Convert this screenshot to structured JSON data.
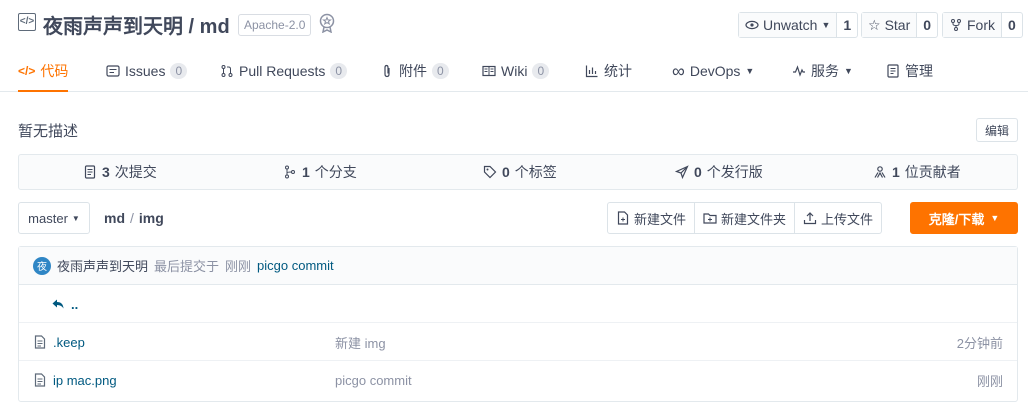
{
  "repo": {
    "icon": "code-repo-icon",
    "title": "夜雨声声到天明 / md",
    "license": "Apache-2.0"
  },
  "social": {
    "watch_label": "Unwatch",
    "watch_count": "1",
    "star_label": "Star",
    "star_count": "0",
    "fork_label": "Fork",
    "fork_count": "0"
  },
  "tabs": [
    {
      "label": "代码",
      "count": ""
    },
    {
      "label": "Issues",
      "count": "0"
    },
    {
      "label": "Pull Requests",
      "count": "0"
    },
    {
      "label": "附件",
      "count": "0"
    },
    {
      "label": "Wiki",
      "count": "0"
    },
    {
      "label": "统计",
      "count": ""
    },
    {
      "label": "DevOps",
      "count": ""
    },
    {
      "label": "服务",
      "count": ""
    },
    {
      "label": "管理",
      "count": ""
    }
  ],
  "description": "暂无描述",
  "edit_label": "编辑",
  "stats": [
    {
      "num": "3",
      "label": "次提交"
    },
    {
      "num": "1",
      "label": "个分支"
    },
    {
      "num": "0",
      "label": "个标签"
    },
    {
      "num": "0",
      "label": "个发行版"
    },
    {
      "num": "1",
      "label": "位贡献者"
    }
  ],
  "branch": "master",
  "path": {
    "root": "md",
    "sep": "/",
    "dir": "img"
  },
  "actions": {
    "new_file": "新建文件",
    "new_folder": "新建文件夹",
    "upload": "上传文件"
  },
  "clone_label": "克隆/下载",
  "last_commit": {
    "avatar": "夜",
    "author": "夜雨声声到天明",
    "prefix": "最后提交于",
    "time": "刚刚",
    "message": "picgo commit"
  },
  "parent_dir": "..",
  "files": [
    {
      "name": ".keep",
      "message": "新建 img",
      "time": "2分钟前"
    },
    {
      "name": "ip mac.png",
      "message": "picgo commit",
      "time": "刚刚"
    }
  ],
  "colors": {
    "accent": "#fe7300",
    "link": "#005980"
  }
}
